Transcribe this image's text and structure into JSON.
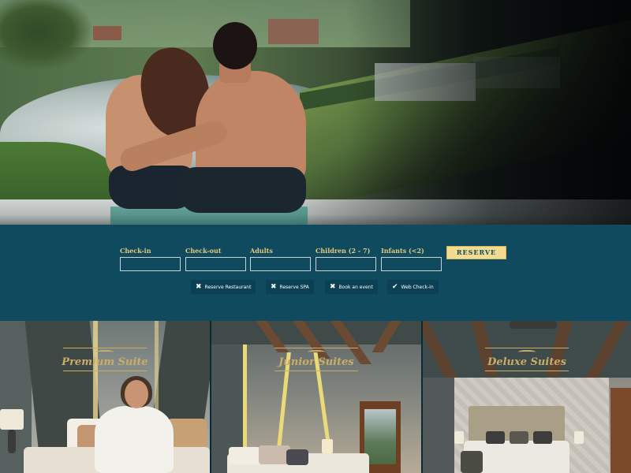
{
  "booking": {
    "fields": [
      {
        "label": "Check-in",
        "value": ""
      },
      {
        "label": "Check-out",
        "value": ""
      },
      {
        "label": "Adults",
        "value": ""
      },
      {
        "label": "Children (2 - 7)",
        "value": ""
      },
      {
        "label": "Infants (<2)",
        "value": ""
      }
    ],
    "reserve_label": "RESERVE",
    "quick_links": [
      {
        "label": "Reserve Restaurant",
        "icon": "utensils-icon",
        "glyph": "✖"
      },
      {
        "label": "Reserve SPA",
        "icon": "spa-icon",
        "glyph": "✖"
      },
      {
        "label": "Book an event",
        "icon": "event-icon",
        "glyph": "✖"
      },
      {
        "label": "Web Check-in",
        "icon": "check-icon",
        "glyph": "✔"
      }
    ]
  },
  "suites": [
    {
      "title": "Premium Suite"
    },
    {
      "title": "Junior Suites"
    },
    {
      "title": "Deluxe Suites"
    }
  ],
  "colors": {
    "band_background": "#0f4a5e",
    "accent_gold": "#c9ad69",
    "reserve_button": "#f1dc91"
  }
}
